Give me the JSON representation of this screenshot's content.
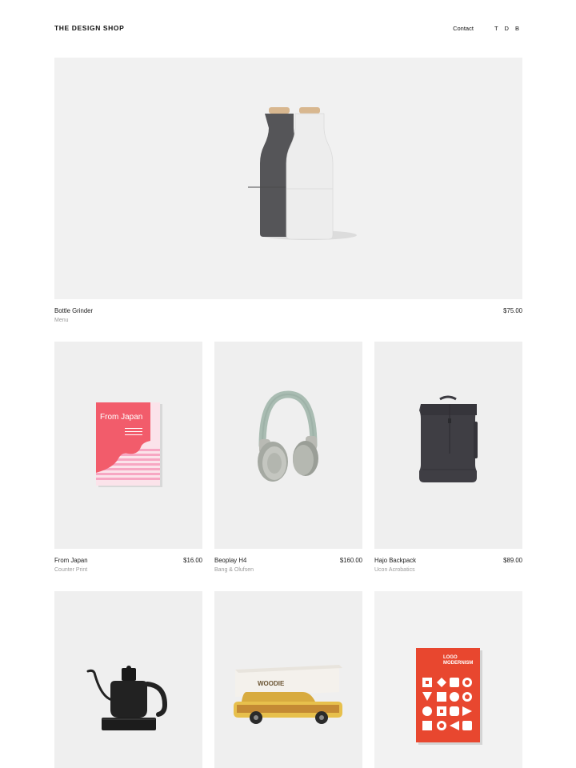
{
  "header": {
    "brand": "THE DESIGN SHOP",
    "contact": "Contact",
    "cart": "T D B"
  },
  "hero": {
    "name": "Bottle Grinder",
    "maker": "Menu",
    "price": "$75.00"
  },
  "products": [
    {
      "name": "From Japan",
      "maker": "Counter Print",
      "price": "$16.00",
      "cover_title": "From Japan"
    },
    {
      "name": "Beoplay H4",
      "maker": "Bang & Olufsen",
      "price": "$160.00"
    },
    {
      "name": "Hajo Backpack",
      "maker": "Ucon Acrobatics",
      "price": "$89.00"
    },
    {
      "name": "",
      "maker": "",
      "price": ""
    },
    {
      "name": "",
      "maker": "",
      "price": "",
      "box_label": "WOODIE"
    },
    {
      "name": "",
      "maker": "",
      "price": "",
      "cover_title": "LOGO\nMODERNISM"
    }
  ],
  "colors": {
    "tile_bg": "#efefef",
    "book_pink": "#f25c6b",
    "book_red": "#e8472f",
    "headphone_green": "#a9bcb2"
  }
}
